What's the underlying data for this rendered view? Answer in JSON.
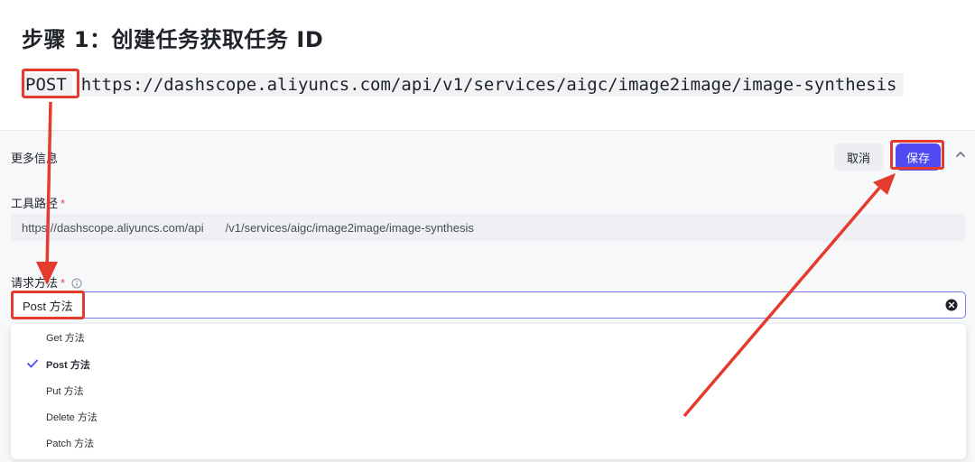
{
  "step": {
    "title": "步骤 1：创建任务获取任务 ID"
  },
  "request_line": {
    "method": "POST",
    "url": "https://dashscope.aliyuncs.com/api/v1/services/aigc/image2image/image-synthesis"
  },
  "panel": {
    "title": "更多信息",
    "cancel_label": "取消",
    "save_label": "保存",
    "tool_path": {
      "label": "工具路径",
      "base": "https://dashscope.aliyuncs.com/api",
      "path": "/v1/services/aigc/image2image/image-synthesis"
    },
    "request_method": {
      "label": "请求方法",
      "value": "Post 方法",
      "options": [
        {
          "label": "Get 方法",
          "selected": false
        },
        {
          "label": "Post 方法",
          "selected": true
        },
        {
          "label": "Put 方法",
          "selected": false
        },
        {
          "label": "Delete 方法",
          "selected": false
        },
        {
          "label": "Patch 方法",
          "selected": false
        }
      ]
    }
  },
  "colors": {
    "accent": "#4f4af2",
    "annotation_red": "#e53a2e",
    "required_star": "#e5484d"
  },
  "icons": [
    "chevron-up-icon",
    "info-icon",
    "clear-icon",
    "check-icon"
  ]
}
